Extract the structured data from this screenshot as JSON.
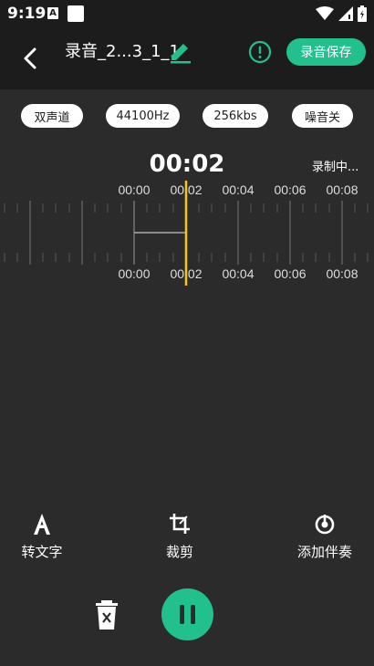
{
  "status_bar": {
    "time": "9:19",
    "notif_letter": "A"
  },
  "header": {
    "title": "录音_2...3_1_1",
    "save_label": "录音保存"
  },
  "settings_chips": [
    "双声道",
    "44100Hz",
    "256kbs",
    "噪音关"
  ],
  "recording": {
    "elapsed": "00:02",
    "status": "录制中..."
  },
  "timeline": {
    "top_ticks": [
      "00:00",
      "00:02",
      "00:04",
      "00:06",
      "00:08"
    ],
    "bottom_ticks": [
      "00:00",
      "00:02",
      "00:04",
      "00:06",
      "00:08"
    ]
  },
  "tools": [
    {
      "label": "转文字",
      "icon": "text-a-icon"
    },
    {
      "label": "裁剪",
      "icon": "crop-icon"
    },
    {
      "label": "添加伴奏",
      "icon": "accompaniment-icon"
    }
  ],
  "colors": {
    "accent": "#22c08c",
    "playhead": "#f5c518",
    "background": "#2b2b2b",
    "bar": "#1c1c1c"
  }
}
